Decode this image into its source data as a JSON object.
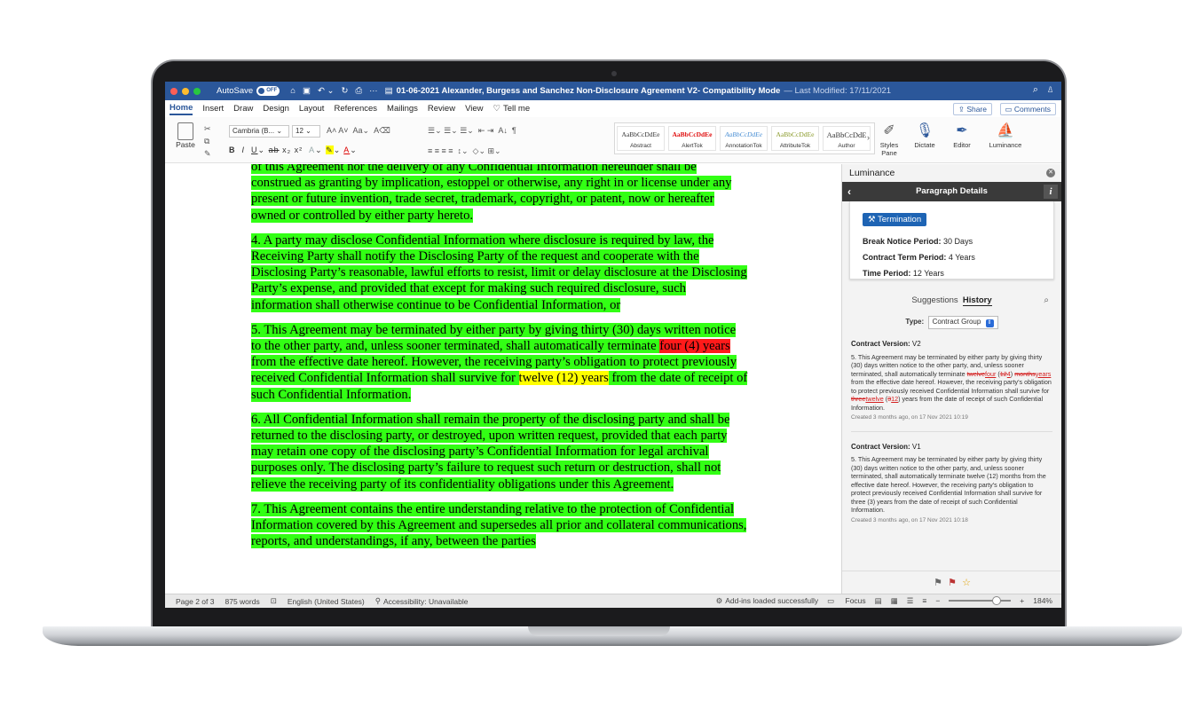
{
  "titlebar": {
    "autosave_label": "AutoSave",
    "autosave_state": "OFF",
    "document_title": "01-06-2021 Alexander, Burgess and Sanchez Non-Disclosure Agreement V2",
    "mode": " - Compatibility Mode",
    "last_modified": "— Last Modified: 17/11/2021"
  },
  "ribbon": {
    "tabs": [
      "Home",
      "Insert",
      "Draw",
      "Design",
      "Layout",
      "References",
      "Mailings",
      "Review",
      "View",
      "Tell me"
    ],
    "share_label": "Share",
    "comments_label": "Comments",
    "paste_label": "Paste",
    "font_name": "Cambria (B...",
    "font_size": "12",
    "styles": [
      {
        "sample": "AaBbCcDdEe",
        "name": "Abstract",
        "color": "#333333"
      },
      {
        "sample": "AaBbCcDdEe",
        "name": "AlertTok",
        "color": "#e01010"
      },
      {
        "sample": "AaBbCcDdEe",
        "name": "AnnotationTok",
        "color": "#4a8fd4"
      },
      {
        "sample": "AaBbCcDdEe",
        "name": "AttributeTok",
        "color": "#8a9a2a"
      },
      {
        "sample": "AaBbCcDdE",
        "name": "Author",
        "color": "#333333"
      }
    ],
    "styles_pane_label": "Styles Pane",
    "dictate_label": "Dictate",
    "editor_label": "Editor",
    "luminance_label": "Luminance"
  },
  "document": {
    "p0": "of this Agreement nor the delivery of any Confidential Information hereunder shall be construed as granting by implication, estoppel or otherwise, any right in or license under any present or future invention, trade secret, trademark, copyright, or patent, now or hereafter owned or controlled by either party hereto.",
    "p4": "4. A party may disclose Confidential Information where disclosure is required by law, the Receiving Party shall notify the Disclosing Party of the request and cooperate with the Disclosing Party’s reasonable, lawful efforts to resist, limit or delay disclosure at the Disclosing Party’s expense, and provided that except for making such required disclosure, such information shall otherwise continue to be Confidential Information, or",
    "p5_a": "5. This Agreement may be terminated by either party by giving thirty (30) days written notice to the other party, and, unless sooner terminated, shall automatically terminate ",
    "p5_red": "four (4) years",
    "p5_b": " from the effective date hereof. However, the receiving party’s obligation to protect previously received Confidential Information shall survive for ",
    "p5_yellow": "twelve (12) years",
    "p5_c": " from the date of receipt of such Confidential Information.",
    "p6": "6. All Confidential Information shall remain the property of the disclosing party and shall be returned to the disclosing party, or destroyed, upon written request, provided that each party may retain one copy of the disclosing party’s Confidential Information for legal archival purposes only. The disclosing party’s failure to request such return or destruction, shall not relieve the receiving party of its confidentiality obligations under this Agreement.",
    "p7": "7. This Agreement contains the entire understanding relative to the protection of Confidential Information covered by this Agreement and supersedes all prior and collateral communications, reports, and understandings, if any, between the parties",
    "colors": {
      "highlight": "#32ff14",
      "red": "#ff1a1a",
      "yellow": "#ffff00"
    }
  },
  "pane": {
    "title": "Luminance",
    "header": "Paragraph Details",
    "tag": "Termination",
    "break_notice_label": "Break Notice Period:",
    "break_notice_value": "30 Days",
    "contract_term_label": "Contract Term Period:",
    "contract_term_value": "4 Years",
    "time_period_label": "Time Period:",
    "time_period_value": "12 Years",
    "suggestions_label": "Suggestions",
    "history_label": "History",
    "type_label": "Type:",
    "type_value": "Contract Group",
    "v2_label": "Contract Version:",
    "v2_value": "V2",
    "v2_text_a": "5. This Agreement may be terminated by either party by giving thirty (30) days written notice to the other party, and, unless sooner terminated, shall automatically terminate ",
    "v2_del1": "twelve",
    "v2_ins1": "four",
    "v2_mid1": " (",
    "v2_del2": "12",
    "v2_ins2": "4",
    "v2_mid2": ") ",
    "v2_del3": "months",
    "v2_ins3": "years",
    "v2_text_b": " from the effective date hereof. However, the receiving party’s obligation to protect previously received Confidential Information shall survive for ",
    "v2_del4": "three",
    "v2_ins4": "twelve",
    "v2_mid3": " (",
    "v2_del5": "3",
    "v2_ins5": "12",
    "v2_text_c": ") years from the date of receipt of such Confidential Information.",
    "v2_meta": "Created 3 months ago, on 17 Nov 2021 10:19",
    "v1_label": "Contract Version:",
    "v1_value": "V1",
    "v1_text": "5. This Agreement may be terminated by either party by giving thirty (30) days written notice to the other party, and, unless sooner terminated, shall automatically terminate twelve (12) months from the effective date hereof. However, the receiving party’s obligation to protect previously received Confidential Information shall survive for three (3) years from the date of receipt of such Confidential Information.",
    "v1_meta": "Created 3 months ago, on 17 Nov 2021 10:18"
  },
  "status": {
    "page": "Page 2 of 3",
    "words": "875 words",
    "language": "English (United States)",
    "accessibility": "Accessibility: Unavailable",
    "addins": "Add-ins loaded successfully",
    "focus": "Focus",
    "zoom": "184%",
    "zoom_fraction": 0.63
  }
}
